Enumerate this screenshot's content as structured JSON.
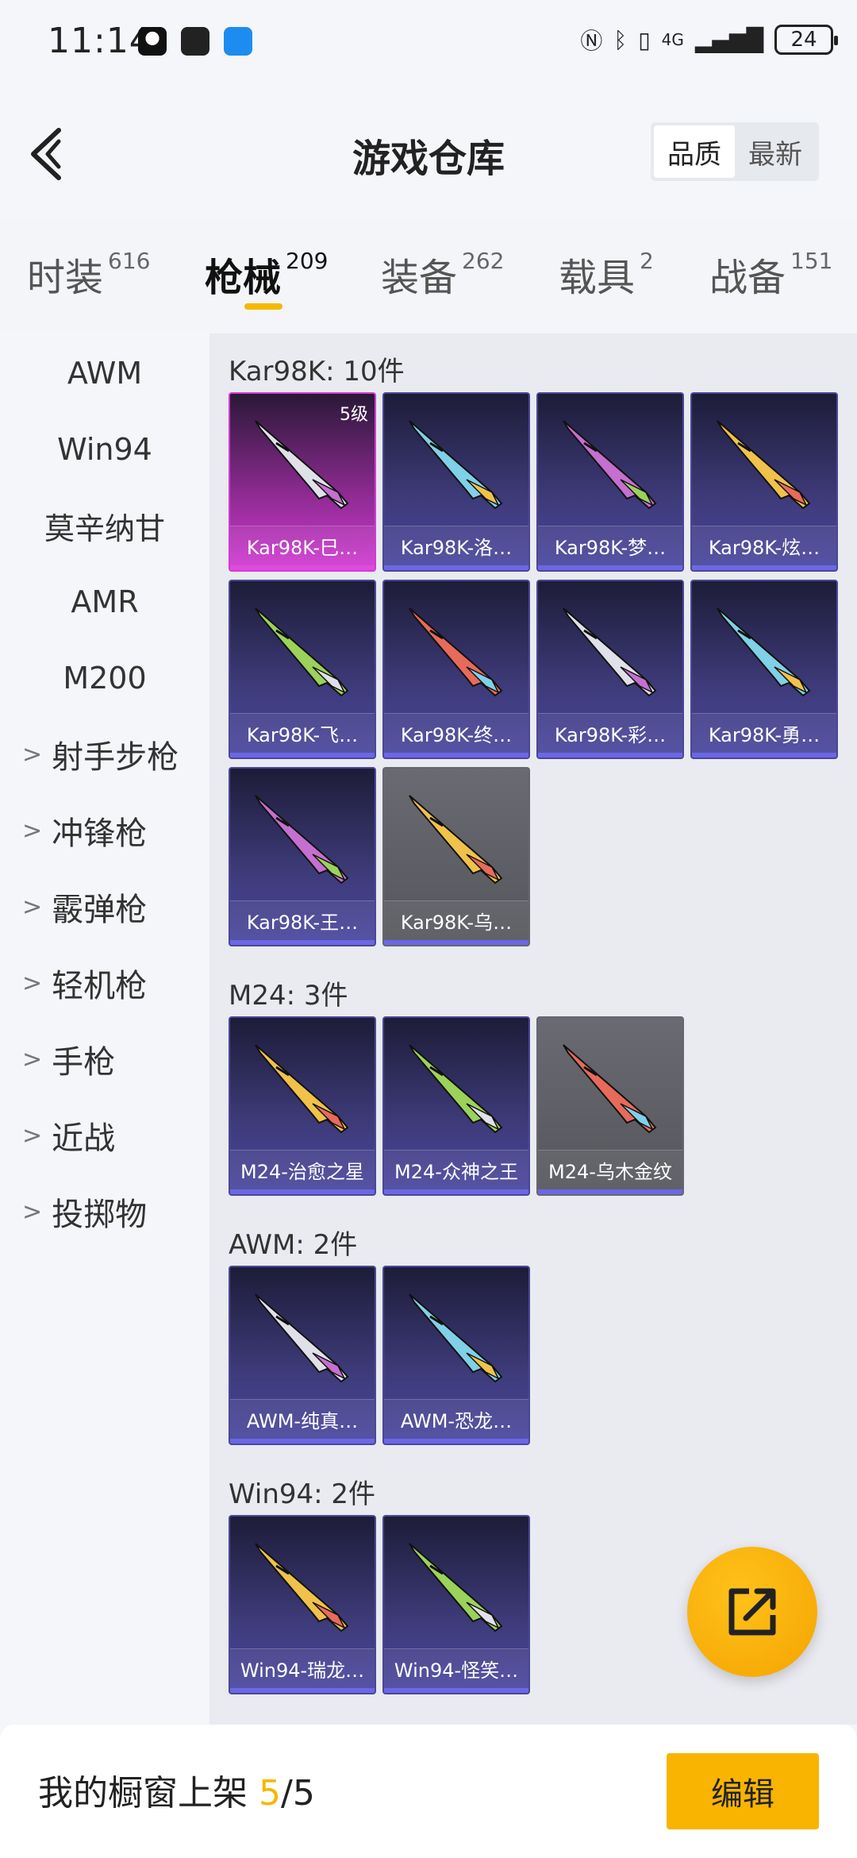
{
  "status_bar": {
    "time": "11:14",
    "battery": "24",
    "network": "4G"
  },
  "header": {
    "title": "游戏仓库",
    "sort_options": [
      {
        "label": "品质",
        "active": true
      },
      {
        "label": "最新",
        "active": false
      }
    ]
  },
  "tabs": [
    {
      "label": "时装",
      "count": "616",
      "active": false
    },
    {
      "label": "枪械",
      "count": "209",
      "active": true
    },
    {
      "label": "装备",
      "count": "262",
      "active": false
    },
    {
      "label": "载具",
      "count": "2",
      "active": false
    },
    {
      "label": "战备",
      "count": "151",
      "active": false
    }
  ],
  "sidebar": {
    "items": [
      {
        "label": "AWM"
      },
      {
        "label": "Win94"
      },
      {
        "label": "莫辛纳甘"
      },
      {
        "label": "AMR"
      },
      {
        "label": "M200"
      }
    ],
    "groups": [
      {
        "label": "射手步枪"
      },
      {
        "label": "冲锋枪"
      },
      {
        "label": "霰弹枪"
      },
      {
        "label": "轻机枪"
      },
      {
        "label": "手枪"
      },
      {
        "label": "近战"
      },
      {
        "label": "投掷物"
      }
    ]
  },
  "sections": [
    {
      "title": "Kar98K: 10件",
      "items": [
        {
          "name": "Kar98K-巳…",
          "level": "5级",
          "style": "pink"
        },
        {
          "name": "Kar98K-洛…",
          "style": "purple"
        },
        {
          "name": "Kar98K-梦…",
          "style": "purple"
        },
        {
          "name": "Kar98K-炫…",
          "style": "purple"
        },
        {
          "name": "Kar98K-飞…",
          "style": "purple"
        },
        {
          "name": "Kar98K-终…",
          "style": "purple"
        },
        {
          "name": "Kar98K-彩…",
          "style": "purple"
        },
        {
          "name": "Kar98K-勇…",
          "style": "purple"
        },
        {
          "name": "Kar98K-王…",
          "style": "purple"
        },
        {
          "name": "Kar98K-乌…",
          "style": "gray"
        }
      ]
    },
    {
      "title": "M24: 3件",
      "items": [
        {
          "name": "M24-治愈之星",
          "style": "purple"
        },
        {
          "name": "M24-众神之王",
          "style": "purple"
        },
        {
          "name": "M24-乌木金纹",
          "style": "gray"
        }
      ]
    },
    {
      "title": "AWM: 2件",
      "items": [
        {
          "name": "AWM-纯真…",
          "style": "purple"
        },
        {
          "name": "AWM-恐龙…",
          "style": "purple"
        }
      ]
    },
    {
      "title": "Win94: 2件",
      "items": [
        {
          "name": "Win94-瑞龙…",
          "style": "purple"
        },
        {
          "name": "Win94-怪笑…",
          "style": "purple"
        }
      ]
    }
  ],
  "bottom": {
    "label": "我的橱窗上架",
    "shelf_count": "5",
    "shelf_total": "/5",
    "edit_label": "编辑"
  },
  "colors": {
    "accent": "#f5b800",
    "card_purple": "#3e3b7a",
    "card_gray": "#5f6066",
    "card_pink": "#d23ad4"
  }
}
